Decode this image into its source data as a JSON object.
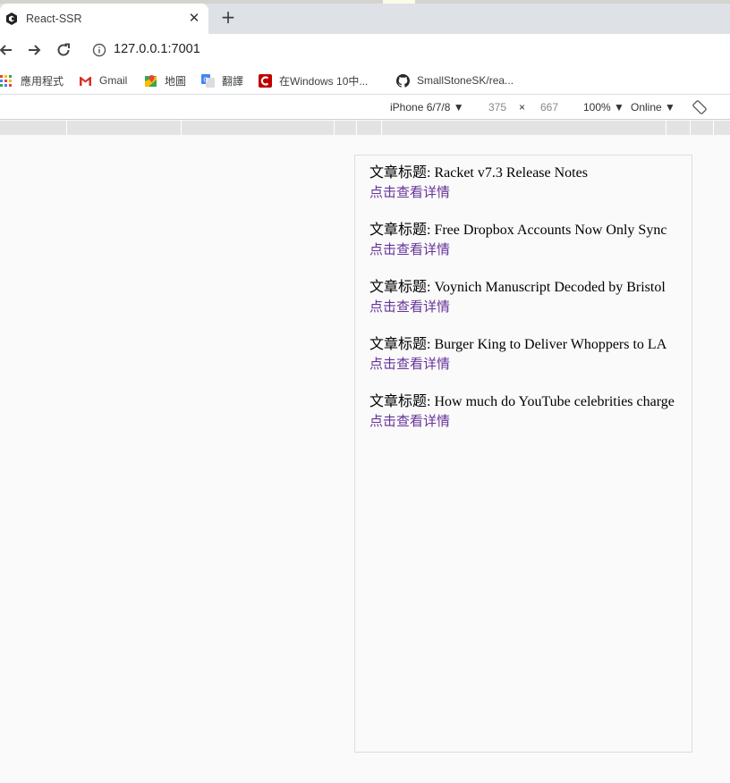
{
  "browser": {
    "tab": {
      "title": "React-SSR",
      "close": "✕"
    },
    "new_tab": "+",
    "url": "127.0.0.1:7001",
    "bookmarks": [
      {
        "label": "應用程式",
        "icon": "apps-grid-icon"
      },
      {
        "label": "Gmail",
        "icon": "gmail-icon"
      },
      {
        "label": "地圖",
        "icon": "maps-icon"
      },
      {
        "label": "翻譯",
        "icon": "translate-icon"
      },
      {
        "label": "在Windows 10中...",
        "icon": "c-logo-icon"
      },
      {
        "label": "SmallStoneSK/rea...",
        "icon": "github-icon"
      }
    ]
  },
  "devtools": {
    "device": "iPhone 6/7/8 ▼",
    "width": "375",
    "times": "×",
    "height": "667",
    "zoom": "100% ▼",
    "network": "Online ▼"
  },
  "articles": [
    {
      "prefix": "文章标题: ",
      "title": "Racket v7.3 Release Notes",
      "link": "点击查看详情"
    },
    {
      "prefix": "文章标题: ",
      "title": "Free Dropbox Accounts Now Only Sync",
      "link": "点击查看详情"
    },
    {
      "prefix": "文章标题: ",
      "title": "Voynich Manuscript Decoded by Bristol",
      "link": "点击查看详情"
    },
    {
      "prefix": "文章标题: ",
      "title": "Burger King to Deliver Whoppers to LA",
      "link": "点击查看详情"
    },
    {
      "prefix": "文章标题: ",
      "title": "How much do YouTube celebrities charge",
      "link": "点击查看详情"
    }
  ],
  "colors": {
    "link": "#663399",
    "tabstrip": "#dee1e6"
  }
}
